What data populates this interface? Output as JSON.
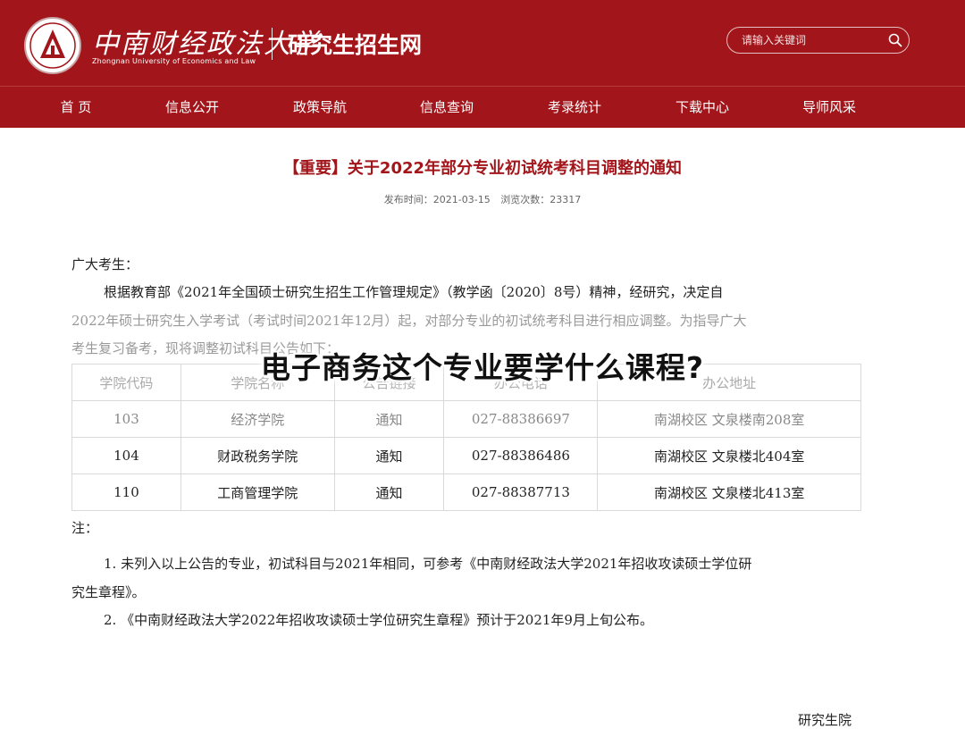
{
  "header": {
    "logo_cn": "中南财经政法大学",
    "logo_en": "Zhongnan University of Economics and Law",
    "site_title": "研究生招生网",
    "search_placeholder": "请输入关键词",
    "brand_color": "#a2161b"
  },
  "nav": {
    "items": [
      {
        "label": "首 页"
      },
      {
        "label": "信息公开"
      },
      {
        "label": "政策导航"
      },
      {
        "label": "信息查询"
      },
      {
        "label": "考录统计"
      },
      {
        "label": "下载中心"
      },
      {
        "label": "导师风采"
      }
    ]
  },
  "article": {
    "title": "【重要】关于2022年部分专业初试统考科目调整的通知",
    "publish_label": "发布时间：",
    "publish_date": "2021-03-15",
    "views_label": "浏览次数：",
    "views": "23317",
    "salutation": "广大考生：",
    "para1_line1": "根据教育部《2021年全国硕士研究生招生工作管理规定》（教学函〔2020〕8号）精神，经研究，决定自",
    "para1_line2": "2022年硕士研究生入学考试（考试时间2021年12月）起，对部分专业的初试统考科目进行相应调整。为指导广大",
    "para1_line3": "考生复习备考，现将调整初试科目公告如下：",
    "table": {
      "headers": [
        "学院代码",
        "学院名称",
        "公告链接",
        "办公电话",
        "办公地址"
      ],
      "rows": [
        [
          "103",
          "经济学院",
          "通知",
          "027-88386697",
          "南湖校区  文泉楼南208室"
        ],
        [
          "104",
          "财政税务学院",
          "通知",
          "027-88386486",
          "南湖校区  文泉楼北404室"
        ],
        [
          "110",
          "工商管理学院",
          "通知",
          "027-88387713",
          "南湖校区  文泉楼北413室"
        ]
      ]
    },
    "note_label": "注：",
    "note1_line1": "1. 未列入以上公告的专业，初试科目与2021年相同，可参考《中南财经政法大学2021年招收攻读硕士学位研",
    "note1_line2": "究生章程》。",
    "note2": "2. 《中南财经政法大学2022年招收攻读硕士学位研究生章程》预计于2021年9月上旬公布。",
    "signature": "研究生院"
  },
  "overlay": {
    "question": "电子商务这个专业要学什么课程?"
  }
}
